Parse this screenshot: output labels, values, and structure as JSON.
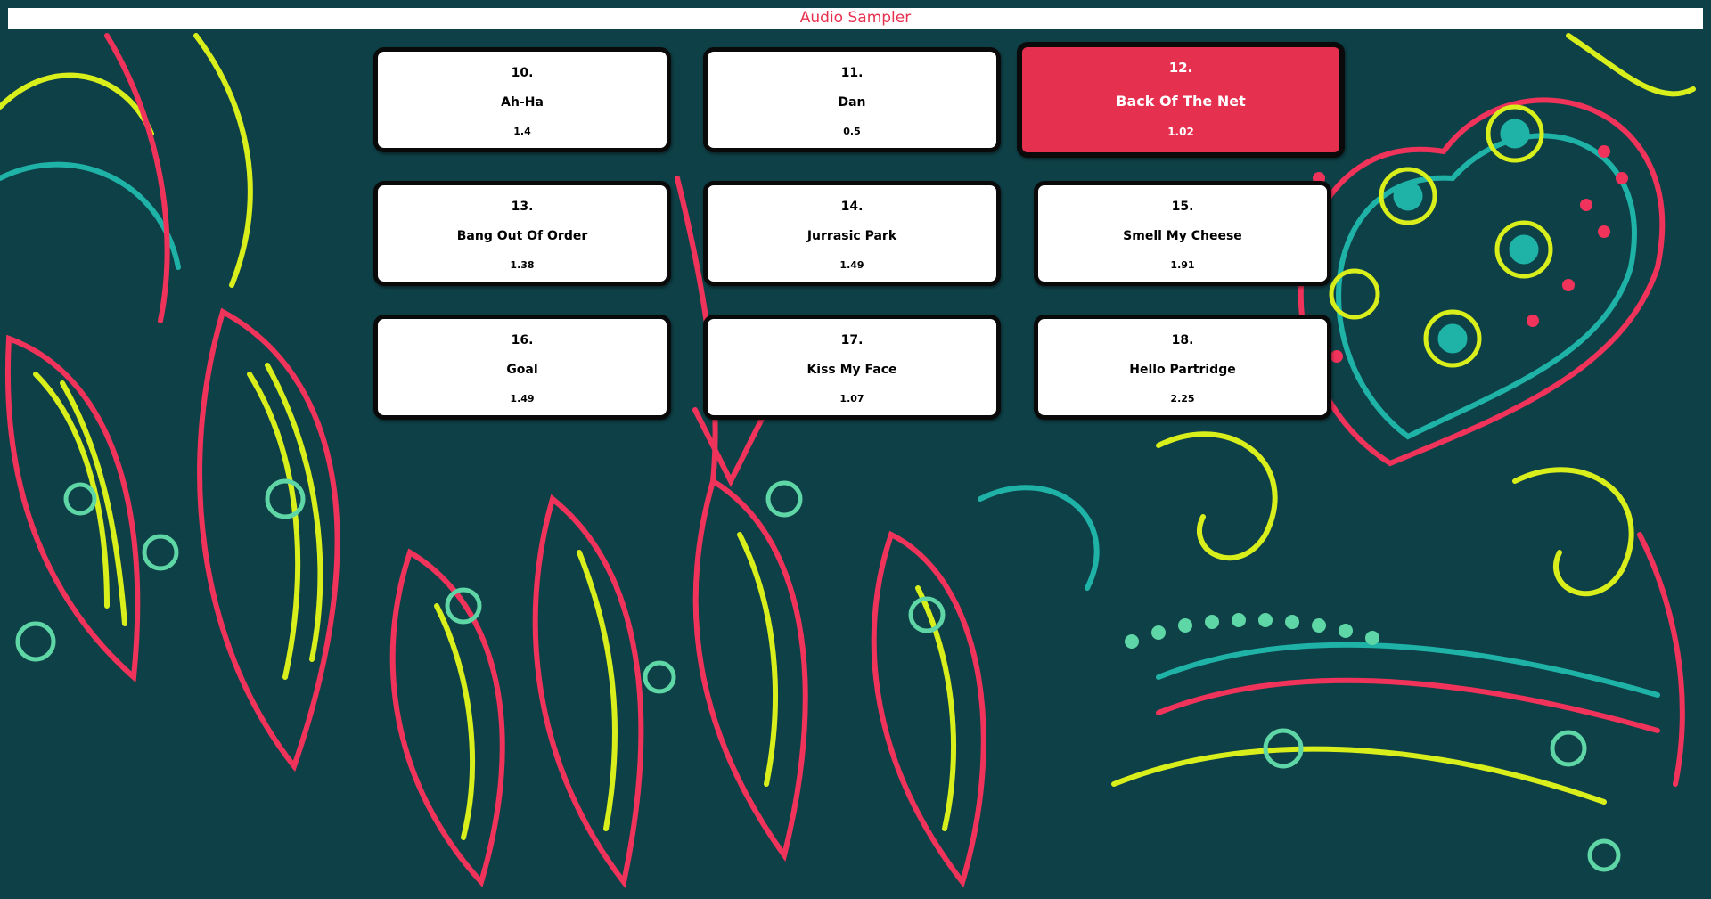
{
  "app": {
    "title": "Audio Sampler"
  },
  "colors": {
    "accent": "#e8304e",
    "active_tile": "#e6304f",
    "background": "#0e4047",
    "pattern_red": "#f0335a",
    "pattern_yellow": "#d9ef1c",
    "pattern_teal": "#1fb3a8",
    "pattern_mint": "#5fd6a5"
  },
  "samples": [
    {
      "number": "10.",
      "name": "Ah-Ha",
      "duration": "1.4",
      "active": false
    },
    {
      "number": "11.",
      "name": "Dan",
      "duration": "0.5",
      "active": false
    },
    {
      "number": "12.",
      "name": "Back Of The Net",
      "duration": "1.02",
      "active": true
    },
    {
      "number": "13.",
      "name": "Bang Out Of Order",
      "duration": "1.38",
      "active": false
    },
    {
      "number": "14.",
      "name": "Jurrasic Park",
      "duration": "1.49",
      "active": false
    },
    {
      "number": "15.",
      "name": "Smell My Cheese",
      "duration": "1.91",
      "active": false
    },
    {
      "number": "16.",
      "name": "Goal",
      "duration": "1.49",
      "active": false
    },
    {
      "number": "17.",
      "name": "Kiss My Face",
      "duration": "1.07",
      "active": false
    },
    {
      "number": "18.",
      "name": "Hello Partridge",
      "duration": "2.25",
      "active": false
    }
  ]
}
